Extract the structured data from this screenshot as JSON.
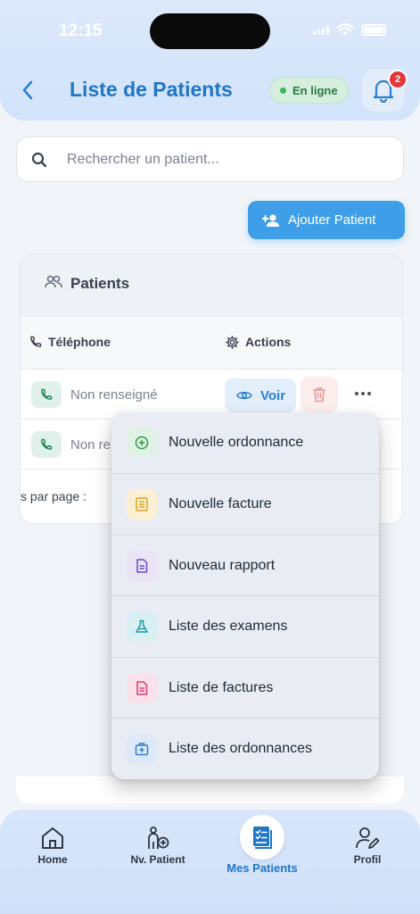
{
  "status_bar": {
    "time": "12:15"
  },
  "header": {
    "title": "Liste de Patients",
    "online_label": "En ligne",
    "notification_count": "2"
  },
  "search": {
    "placeholder": "Rechercher un patient..."
  },
  "add_button": {
    "label": "Ajouter Patient"
  },
  "patients_card": {
    "title": "Patients",
    "columns": {
      "phone": "Téléphone",
      "actions": "Actions"
    },
    "rows": [
      {
        "phone": "Non renseigné",
        "view_label": "Voir"
      },
      {
        "phone": "Non re"
      }
    ],
    "per_page_label": "s par page :"
  },
  "action_menu": {
    "items": [
      {
        "label": "Nouvelle ordonnance",
        "icon": "plus-circle-icon",
        "color": "#2e9a4a",
        "bg": "#dff2e4"
      },
      {
        "label": "Nouvelle facture",
        "icon": "invoice-icon",
        "color": "#e0a126",
        "bg": "#fdf0d2"
      },
      {
        "label": "Nouveau rapport",
        "icon": "report-icon",
        "color": "#6b4bc7",
        "bg": "#ebe4f7"
      },
      {
        "label": "Liste des examens",
        "icon": "flask-icon",
        "color": "#1f9aa3",
        "bg": "#d8f0f2"
      },
      {
        "label": "Liste de factures",
        "icon": "document-list-icon",
        "color": "#e0386b",
        "bg": "#fbe1ea"
      },
      {
        "label": "Liste des ordonnances",
        "icon": "medical-bag-icon",
        "color": "#2b7ed2",
        "bg": "#dde9f8"
      }
    ]
  },
  "bottom_nav": {
    "items": [
      {
        "label": "Home",
        "icon": "home-icon"
      },
      {
        "label": "Nv. Patient",
        "icon": "add-patient-icon"
      },
      {
        "label": "Mes Patients",
        "icon": "patient-list-icon",
        "active": true
      },
      {
        "label": "Profil",
        "icon": "profile-icon"
      }
    ]
  },
  "colors": {
    "accent": "#2076c7",
    "button_blue": "#3f9ee8",
    "danger": "#e3373b",
    "online_green": "#3cb35e"
  }
}
